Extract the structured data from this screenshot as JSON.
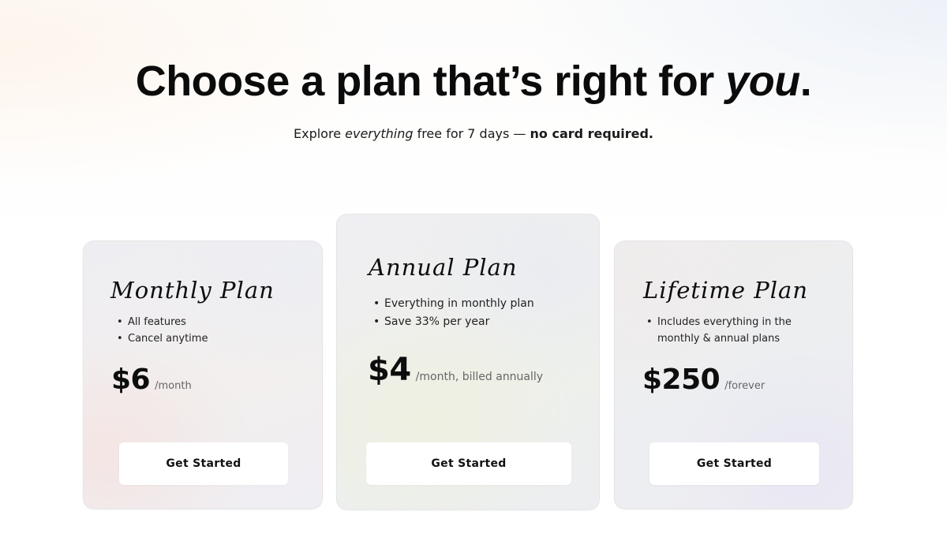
{
  "header": {
    "headline_main": "Choose a plan that’s right for ",
    "headline_emphasis": "you",
    "headline_end": ".",
    "sub_part1": "Explore ",
    "sub_emphasis": "everything",
    "sub_part2": " free for 7 days — ",
    "sub_bold": "no card required."
  },
  "plans": [
    {
      "name": "Monthly Plan",
      "features": [
        "All features",
        "Cancel anytime"
      ],
      "price": "$6",
      "period": "/month",
      "cta_label": "Get Started"
    },
    {
      "name": "Annual Plan",
      "features": [
        "Everything in monthly plan",
        "Save 33% per year"
      ],
      "price": "$4",
      "period": "/month, billed annually",
      "cta_label": "Get Started"
    },
    {
      "name": "Lifetime Plan",
      "features": [
        "Includes everything in the monthly & annual plans"
      ],
      "price": "$250",
      "period": "/forever",
      "cta_label": "Get Started"
    }
  ]
}
